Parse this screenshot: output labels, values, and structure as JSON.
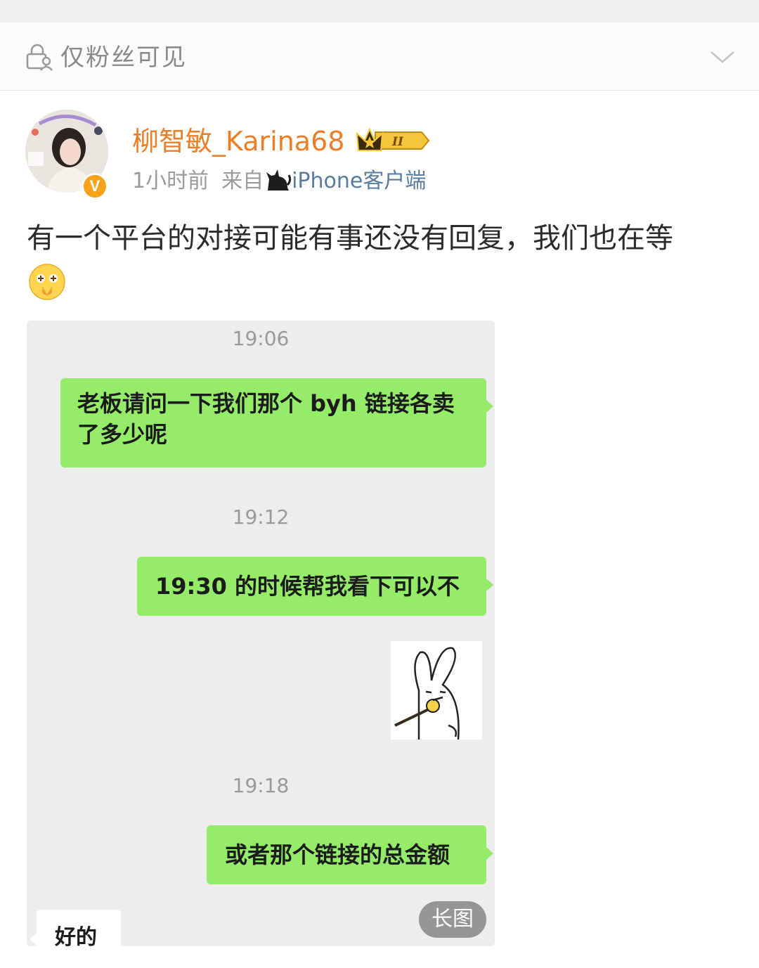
{
  "visibility_bar": {
    "label": "仅粉丝可见",
    "lock_icon": "lock-person-icon",
    "expand_icon": "chevron-down-icon"
  },
  "author": {
    "name": "柳智敏_Karina68",
    "badge_level": "II",
    "verified": "V",
    "time": "1小时前",
    "source_prefix": "来自",
    "source_client": "iPhone客户端"
  },
  "post": {
    "text": "有一个平台的对接可能有事还没有回复，我们也在等",
    "emoji": "pleading-face-emoji"
  },
  "chat_screenshot": {
    "messages": [
      {
        "time": "19:06",
        "text": "老板请问一下我们那个 byh 链接各卖了多少呢"
      },
      {
        "time": "19:12",
        "text": "19:30 的时候帮我看下可以不"
      },
      {
        "sticker": "rabbit-sticker"
      },
      {
        "time": "19:18",
        "text": "或者那个链接的总金额"
      },
      {
        "reply_text": "好的"
      }
    ],
    "long_image_label": "长图"
  },
  "colors": {
    "username": "#ea7f28",
    "bubble_green": "#95ec69",
    "client_link": "#5a7c9c"
  }
}
